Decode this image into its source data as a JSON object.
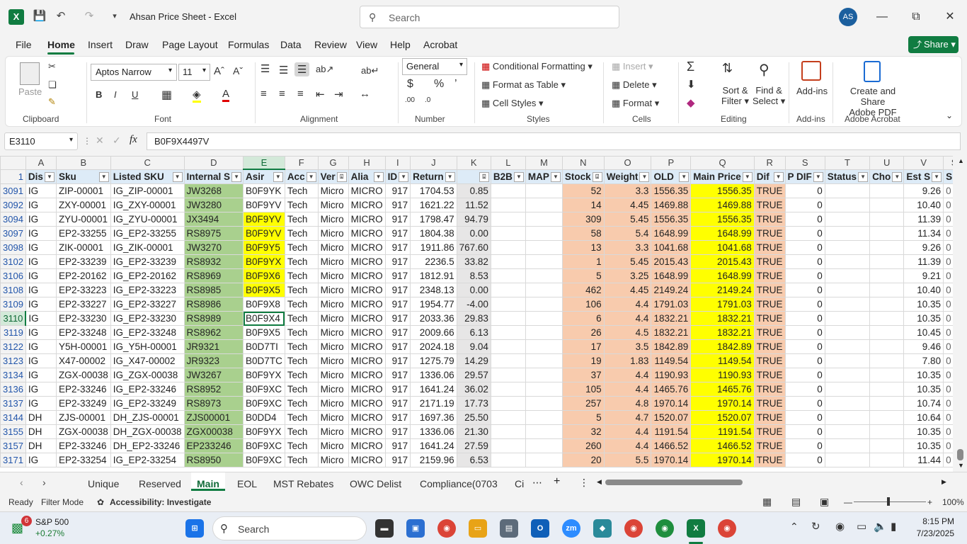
{
  "app": {
    "title": "Ahsan Price Sheet  -  Excel",
    "search_placeholder": "Search",
    "user_initials": "AS",
    "share_label": "Share"
  },
  "menu": [
    "File",
    "Home",
    "Insert",
    "Draw",
    "Page Layout",
    "Formulas",
    "Data",
    "Review",
    "View",
    "Help",
    "Acrobat"
  ],
  "ribbon": {
    "clipboard": {
      "paste": "Paste",
      "label": "Clipboard"
    },
    "font": {
      "name": "Aptos Narrow",
      "size": "11",
      "label": "Font"
    },
    "alignment": {
      "label": "Alignment"
    },
    "number": {
      "format": "General",
      "label": "Number"
    },
    "styles": {
      "conditional": "Conditional Formatting",
      "format_table": "Format as Table",
      "cell_styles": "Cell Styles",
      "label": "Styles"
    },
    "cells": {
      "insert": "Insert",
      "delete": "Delete",
      "format": "Format",
      "label": "Cells"
    },
    "editing": {
      "sort": "Sort &",
      "sort2": "Filter",
      "find": "Find &",
      "find2": "Select",
      "label": "Editing"
    },
    "addins": {
      "btn": "Add-ins",
      "label": "Add-ins"
    },
    "acrobat": {
      "btn1": "Create and Share",
      "btn2": "Adobe PDF",
      "label": "Adobe Acrobat"
    }
  },
  "formula_bar": {
    "name_box": "E3110",
    "fx": "fx",
    "value": "B0F9X4497V"
  },
  "columns": [
    "A",
    "B",
    "C",
    "D",
    "E",
    "F",
    "G",
    "H",
    "I",
    "J",
    "K",
    "L",
    "M",
    "N",
    "O",
    "P",
    "Q",
    "R",
    "S",
    "T",
    "U",
    "V"
  ],
  "headers": [
    "Dis",
    "Sku",
    "Listed SKU",
    "Internal S",
    "Asir",
    "Acc",
    "Ver",
    "Alia",
    "ID",
    "Return",
    "",
    "B2B",
    "MAP",
    "Stock",
    "Weight",
    "OLD",
    "Main Price",
    "Dif",
    "P DIF",
    "Status",
    "Cho",
    "Est S"
  ],
  "rows": [
    {
      "r": "3091",
      "c": [
        "IG",
        "ZIP-00001",
        "IG_ZIP-00001",
        "JW3268",
        "B0F9YK",
        "Tech",
        "Micro",
        "MICRO",
        "917",
        "1704.53",
        "0.85",
        "",
        "",
        "52",
        "3.3",
        "1556.35",
        "1556.35",
        "TRUE",
        "0",
        "",
        "",
        "9.26"
      ],
      "e_yellow": false
    },
    {
      "r": "3092",
      "c": [
        "IG",
        "ZXY-00001",
        "IG_ZXY-00001",
        "JW3280",
        "B0F9YV",
        "Tech",
        "Micro",
        "MICRO",
        "917",
        "1621.22",
        "11.52",
        "",
        "",
        "14",
        "4.45",
        "1469.88",
        "1469.88",
        "TRUE",
        "0",
        "",
        "",
        "10.40"
      ],
      "e_yellow": false
    },
    {
      "r": "3094",
      "c": [
        "IG",
        "ZYU-00001",
        "IG_ZYU-00001",
        "JX3494",
        "B0F9YV",
        "Tech",
        "Micro",
        "MICRO",
        "917",
        "1798.47",
        "94.79",
        "",
        "",
        "309",
        "5.45",
        "1556.35",
        "1556.35",
        "TRUE",
        "0",
        "",
        "",
        "11.39"
      ],
      "e_yellow": true
    },
    {
      "r": "3097",
      "c": [
        "IG",
        "EP2-33255",
        "IG_EP2-33255",
        "RS8975",
        "B0F9YV",
        "Tech",
        "Micro",
        "MICRO",
        "917",
        "1804.38",
        "0.00",
        "",
        "",
        "58",
        "5.4",
        "1648.99",
        "1648.99",
        "TRUE",
        "0",
        "",
        "",
        "11.34"
      ],
      "e_yellow": true
    },
    {
      "r": "3098",
      "c": [
        "IG",
        "ZIK-00001",
        "IG_ZIK-00001",
        "JW3270",
        "B0F9Y5",
        "Tech",
        "Micro",
        "MICRO",
        "917",
        "1911.86",
        "767.60",
        "",
        "",
        "13",
        "3.3",
        "1041.68",
        "1041.68",
        "TRUE",
        "0",
        "",
        "",
        "9.26"
      ],
      "e_yellow": true
    },
    {
      "r": "3102",
      "c": [
        "IG",
        "EP2-33239",
        "IG_EP2-33239",
        "RS8932",
        "B0F9YX",
        "Tech",
        "Micro",
        "MICRO",
        "917",
        "2236.5",
        "33.82",
        "",
        "",
        "1",
        "5.45",
        "2015.43",
        "2015.43",
        "TRUE",
        "0",
        "",
        "",
        "11.39"
      ],
      "e_yellow": true
    },
    {
      "r": "3106",
      "c": [
        "IG",
        "EP2-20162",
        "IG_EP2-20162",
        "RS8969",
        "B0F9X6",
        "Tech",
        "Micro",
        "MICRO",
        "917",
        "1812.91",
        "8.53",
        "",
        "",
        "5",
        "3.25",
        "1648.99",
        "1648.99",
        "TRUE",
        "0",
        "",
        "",
        "9.21"
      ],
      "e_yellow": true
    },
    {
      "r": "3108",
      "c": [
        "IG",
        "EP2-33223",
        "IG_EP2-33223",
        "RS8985",
        "B0F9X5",
        "Tech",
        "Micro",
        "MICRO",
        "917",
        "2348.13",
        "0.00",
        "",
        "",
        "462",
        "4.45",
        "2149.24",
        "2149.24",
        "TRUE",
        "0",
        "",
        "",
        "10.40"
      ],
      "e_yellow": true
    },
    {
      "r": "3109",
      "c": [
        "IG",
        "EP2-33227",
        "IG_EP2-33227",
        "RS8986",
        "B0F9X8",
        "Tech",
        "Micro",
        "MICRO",
        "917",
        "1954.77",
        "-4.00",
        "",
        "",
        "106",
        "4.4",
        "1791.03",
        "1791.03",
        "TRUE",
        "0",
        "",
        "",
        "10.35"
      ],
      "e_yellow": false
    },
    {
      "r": "3110",
      "c": [
        "IG",
        "EP2-33230",
        "IG_EP2-33230",
        "RS8989",
        "B0F9X4",
        "Tech",
        "Micro",
        "MICRO",
        "917",
        "2033.36",
        "29.83",
        "",
        "",
        "6",
        "4.4",
        "1832.21",
        "1832.21",
        "TRUE",
        "0",
        "",
        "",
        "10.35"
      ],
      "e_yellow": false
    },
    {
      "r": "3119",
      "c": [
        "IG",
        "EP2-33248",
        "IG_EP2-33248",
        "RS8962",
        "B0F9X5",
        "Tech",
        "Micro",
        "MICRO",
        "917",
        "2009.66",
        "6.13",
        "",
        "",
        "26",
        "4.5",
        "1832.21",
        "1832.21",
        "TRUE",
        "0",
        "",
        "",
        "10.45"
      ],
      "e_yellow": false
    },
    {
      "r": "3122",
      "c": [
        "IG",
        "Y5H-00001",
        "IG_Y5H-00001",
        "JR9321",
        "B0D7TI",
        "Tech",
        "Micro",
        "MICRO",
        "917",
        "2024.18",
        "9.04",
        "",
        "",
        "17",
        "3.5",
        "1842.89",
        "1842.89",
        "TRUE",
        "0",
        "",
        "",
        "9.46"
      ],
      "e_yellow": false
    },
    {
      "r": "3123",
      "c": [
        "IG",
        "X47-00002",
        "IG_X47-00002",
        "JR9323",
        "B0D7TC",
        "Tech",
        "Micro",
        "MICRO",
        "917",
        "1275.79",
        "14.29",
        "",
        "",
        "19",
        "1.83",
        "1149.54",
        "1149.54",
        "TRUE",
        "0",
        "",
        "",
        "7.80"
      ],
      "e_yellow": false
    },
    {
      "r": "3134",
      "c": [
        "IG",
        "ZGX-00038",
        "IG_ZGX-00038",
        "JW3267",
        "B0F9YX",
        "Tech",
        "Micro",
        "MICRO",
        "917",
        "1336.06",
        "29.57",
        "",
        "",
        "37",
        "4.4",
        "1190.93",
        "1190.93",
        "TRUE",
        "0",
        "",
        "",
        "10.35"
      ],
      "e_yellow": false
    },
    {
      "r": "3136",
      "c": [
        "IG",
        "EP2-33246",
        "IG_EP2-33246",
        "RS8952",
        "B0F9XC",
        "Tech",
        "Micro",
        "MICRO",
        "917",
        "1641.24",
        "36.02",
        "",
        "",
        "105",
        "4.4",
        "1465.76",
        "1465.76",
        "TRUE",
        "0",
        "",
        "",
        "10.35"
      ],
      "e_yellow": false
    },
    {
      "r": "3137",
      "c": [
        "IG",
        "EP2-33249",
        "IG_EP2-33249",
        "RS8973",
        "B0F9XC",
        "Tech",
        "Micro",
        "MICRO",
        "917",
        "2171.19",
        "17.73",
        "",
        "",
        "257",
        "4.8",
        "1970.14",
        "1970.14",
        "TRUE",
        "0",
        "",
        "",
        "10.74"
      ],
      "e_yellow": false
    },
    {
      "r": "3144",
      "c": [
        "DH",
        "ZJS-00001",
        "DH_ZJS-00001",
        "ZJS00001",
        "B0DD4",
        "Tech",
        "Micro",
        "MICRO",
        "917",
        "1697.36",
        "25.50",
        "",
        "",
        "5",
        "4.7",
        "1520.07",
        "1520.07",
        "TRUE",
        "0",
        "",
        "",
        "10.64"
      ],
      "e_yellow": false
    },
    {
      "r": "3155",
      "c": [
        "DH",
        "ZGX-00038",
        "DH_ZGX-00038",
        "ZGX00038",
        "B0F9YX",
        "Tech",
        "Micro",
        "MICRO",
        "917",
        "1336.06",
        "21.30",
        "",
        "",
        "32",
        "4.4",
        "1191.54",
        "1191.54",
        "TRUE",
        "0",
        "",
        "",
        "10.35"
      ],
      "e_yellow": false
    },
    {
      "r": "3157",
      "c": [
        "DH",
        "EP2-33246",
        "DH_EP2-33246",
        "EP233246",
        "B0F9XC",
        "Tech",
        "Micro",
        "MICRO",
        "917",
        "1641.24",
        "27.59",
        "",
        "",
        "260",
        "4.4",
        "1466.52",
        "1466.52",
        "TRUE",
        "0",
        "",
        "",
        "10.35"
      ],
      "e_yellow": false
    },
    {
      "r": "3171",
      "c": [
        "IG",
        "EP2-33254",
        "IG_EP2-33254",
        "RS8950",
        "B0F9XC",
        "Tech",
        "Micro",
        "MICRO",
        "917",
        "2159.96",
        "6.53",
        "",
        "",
        "20",
        "5.5",
        "1970.14",
        "1970.14",
        "TRUE",
        "0",
        "",
        "",
        "11.44"
      ],
      "e_yellow": false
    }
  ],
  "tabs": [
    "Unique",
    "Reserved",
    "Main",
    "EOL",
    "MST Rebates",
    "OWC Delist",
    "Compliance(0703",
    "Ci"
  ],
  "active_tab": "Main",
  "status": {
    "ready": "Ready",
    "mode": "Filter Mode",
    "accessibility": "Accessibility: Investigate",
    "zoom": "100%"
  },
  "taskbar": {
    "stock_name": "S&P 500",
    "stock_change": "+0.27%",
    "badge": "6",
    "search": "Search",
    "time": "8:15 PM",
    "date": "7/23/2025"
  },
  "colors": {
    "accent": "#107c41",
    "header_fill": "#ddebf7",
    "green": "#a9d08e",
    "yellow": "#ffff00",
    "salmon": "#f8cbad"
  }
}
